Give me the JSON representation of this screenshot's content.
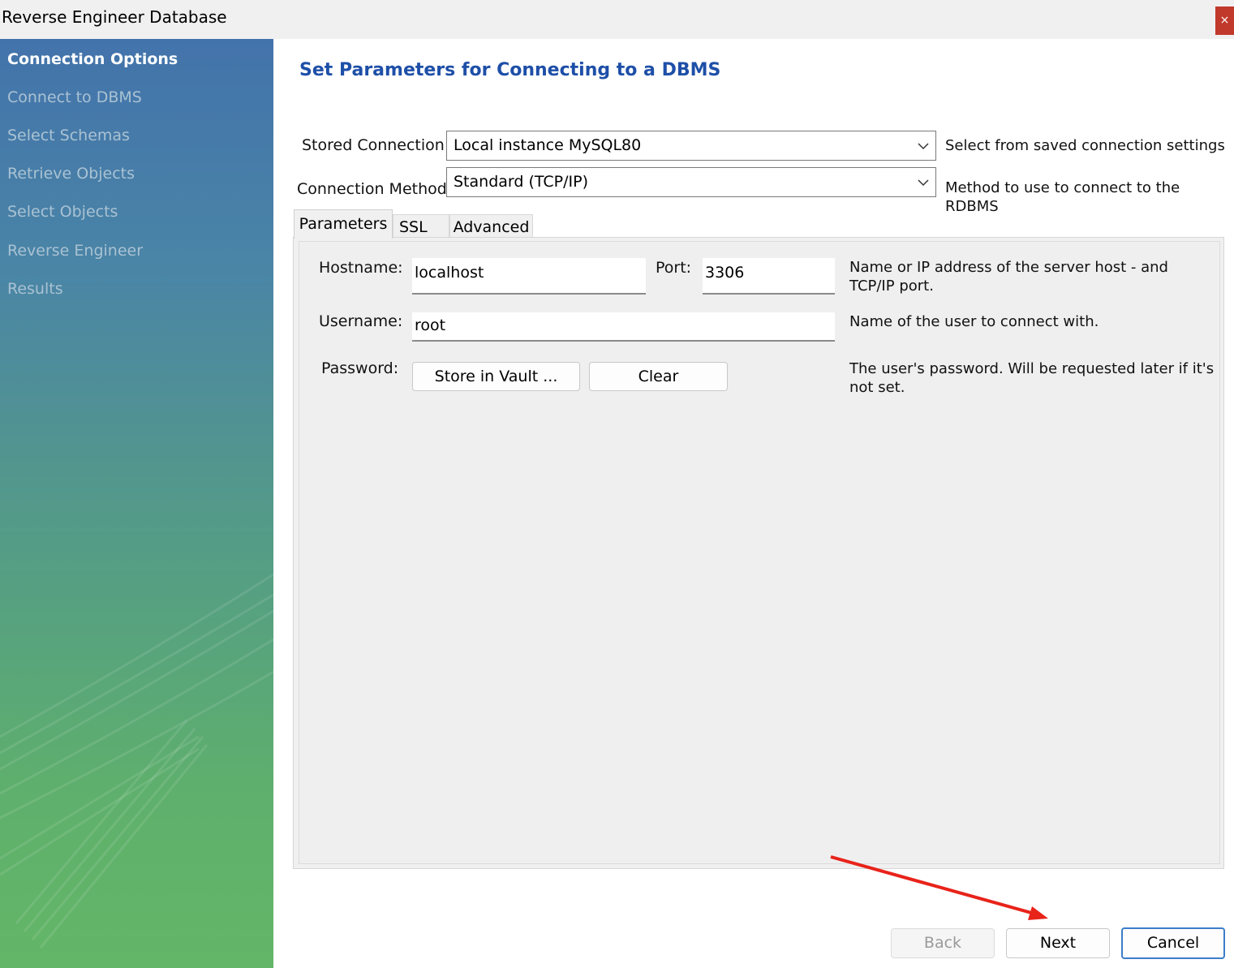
{
  "window": {
    "title": "Reverse Engineer Database",
    "close_label": "×"
  },
  "sidebar": {
    "items": [
      {
        "label": "Connection Options",
        "active": true
      },
      {
        "label": "Connect to DBMS"
      },
      {
        "label": "Select Schemas"
      },
      {
        "label": "Retrieve Objects"
      },
      {
        "label": "Select Objects"
      },
      {
        "label": "Reverse Engineer"
      },
      {
        "label": "Results"
      }
    ]
  },
  "main": {
    "title": "Set Parameters for Connecting to a DBMS",
    "stored_connection": {
      "label": "Stored Connection:",
      "value": "Local instance MySQL80",
      "hint": "Select from saved connection settings"
    },
    "connection_method": {
      "label": "Connection Method:",
      "value": "Standard (TCP/IP)",
      "hint": "Method to use to connect to the RDBMS"
    },
    "tabs": [
      {
        "label": "Parameters",
        "active": true
      },
      {
        "label": "SSL"
      },
      {
        "label": "Advanced"
      }
    ],
    "params": {
      "hostname_label": "Hostname:",
      "hostname_value": "localhost",
      "port_label": "Port:",
      "port_value": "3306",
      "host_hint_line1": "Name or IP address of the server host - and",
      "host_hint_line2": "TCP/IP port.",
      "username_label": "Username:",
      "username_value": "root",
      "username_hint": "Name of the user to connect with.",
      "password_label": "Password:",
      "store_vault_label": "Store in Vault ...",
      "clear_label": "Clear",
      "password_hint_line1": "The user's password. Will be requested later if it's",
      "password_hint_line2": "not set."
    }
  },
  "footer": {
    "back_label": "Back",
    "next_label": "Next",
    "cancel_label": "Cancel"
  },
  "colors": {
    "accent": "#1e4fa8",
    "annotation_arrow": "#e8231a",
    "close": "#c0392b"
  }
}
